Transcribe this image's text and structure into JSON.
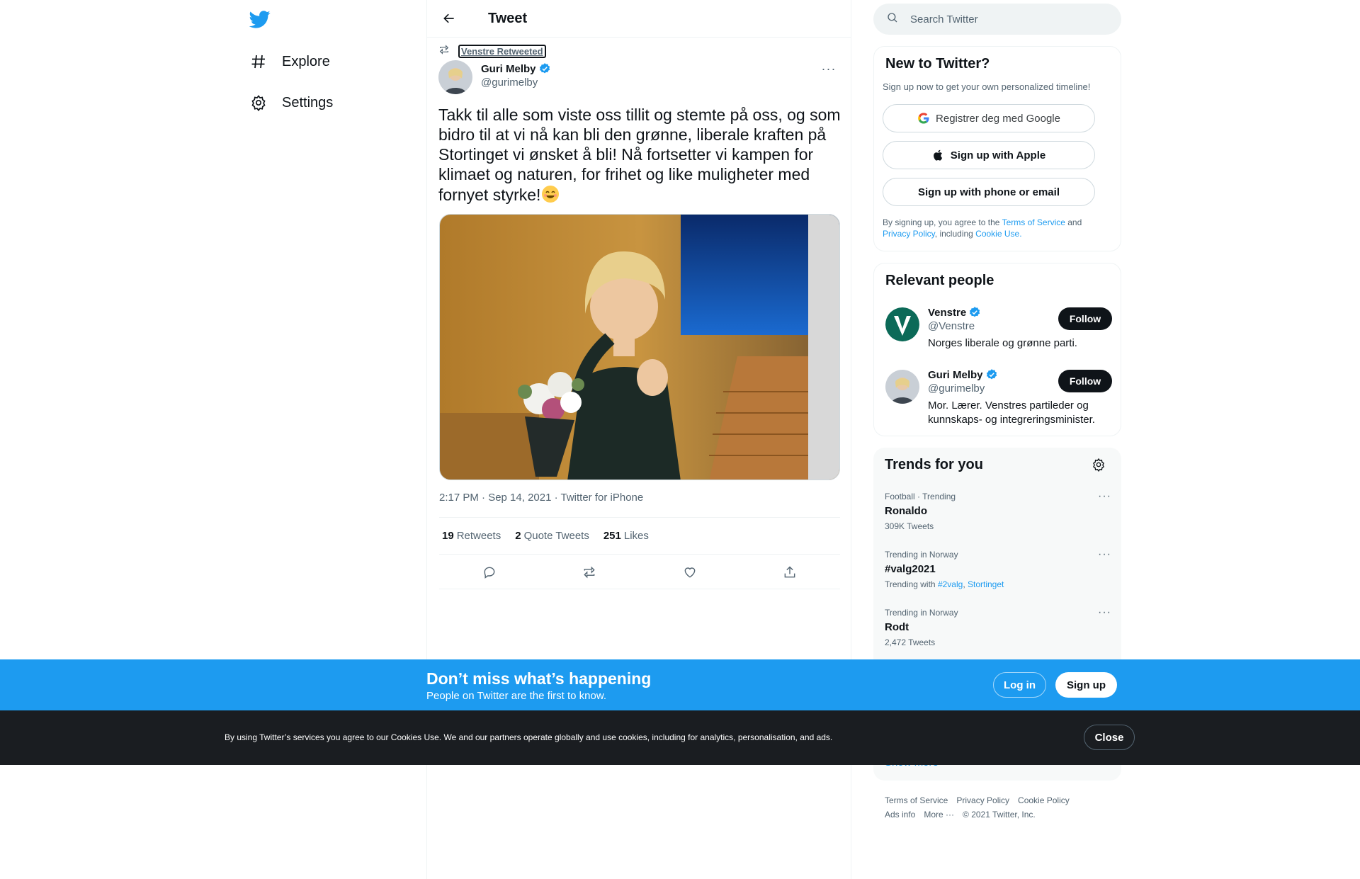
{
  "nav": {
    "items": [
      {
        "label": "Explore",
        "icon": "hashtag-icon"
      },
      {
        "label": "Settings",
        "icon": "gear-icon"
      }
    ]
  },
  "header": {
    "title": "Tweet"
  },
  "tweet": {
    "retweeted_by": "Venstre Retweeted",
    "author_name": "Guri Melby",
    "author_handle": "@gurimelby",
    "text": "Takk til alle som viste oss tillit og stemte på oss, og som bidro til at vi nå kan bli den grønne, liberale kraften på Stortinget vi ønsket å bli! Nå fortsetter vi kampen for klimaet og naturen, for frihet og like muligheter med fornyet styrke!",
    "meta": "2:17 PM · Sep 14, 2021 · Twitter for iPhone",
    "stats": [
      {
        "count": "19",
        "label": "Retweets"
      },
      {
        "count": "2",
        "label": "Quote Tweets"
      },
      {
        "count": "251",
        "label": "Likes"
      }
    ]
  },
  "search": {
    "placeholder": "Search Twitter"
  },
  "new_to_twitter": {
    "title": "New to Twitter?",
    "subtitle": "Sign up now to get your own personalized timeline!",
    "google_label": "Registrer deg med Google",
    "apple_label": "Sign up with Apple",
    "phone_label": "Sign up with phone or email",
    "legal_prefix": "By signing up, you agree to the ",
    "terms": "Terms of Service",
    "and": " and ",
    "privacy": "Privacy Policy",
    "including": ", including ",
    "cookie": "Cookie Use."
  },
  "relevant": {
    "title": "Relevant people",
    "people": [
      {
        "name": "Venstre",
        "handle": "@Venstre",
        "bio": "Norges liberale og grønne parti.",
        "follow": "Follow"
      },
      {
        "name": "Guri Melby",
        "handle": "@gurimelby",
        "bio": "Mor. Lærer. Venstres partileder og kunnskaps- og integreringsminister.",
        "follow": "Follow"
      }
    ]
  },
  "trends": {
    "title": "Trends for you",
    "items": [
      {
        "context": "Football · Trending",
        "name": "Ronaldo",
        "meta": "309K Tweets"
      },
      {
        "context": "Trending in Norway",
        "name": "#valg2021",
        "meta_prefix": "Trending with ",
        "links": [
          "#2valg",
          "Stortinget"
        ]
      },
      {
        "context": "Trending in Norway",
        "name": "Rodt",
        "meta": "2,472 Tweets"
      }
    ],
    "show_more": "Show more"
  },
  "footer": {
    "links": [
      "Terms of Service",
      "Privacy Policy",
      "Cookie Policy",
      "Ads info",
      "More ···",
      "© 2021 Twitter, Inc."
    ]
  },
  "banner": {
    "title": "Don’t miss what’s happening",
    "subtitle": "People on Twitter are the first to know.",
    "login": "Log in",
    "signup": "Sign up"
  },
  "cookie_bar": {
    "text": "By using Twitter’s services you agree to our Cookies Use. We and our partners operate globally and use cookies, including for analytics, personalisation, and ads.",
    "close": "Close"
  },
  "colors": {
    "accent": "#1d9bf0",
    "text": "#0f1419",
    "secondary": "#536471",
    "cookie_bg": "#1a1d21"
  }
}
